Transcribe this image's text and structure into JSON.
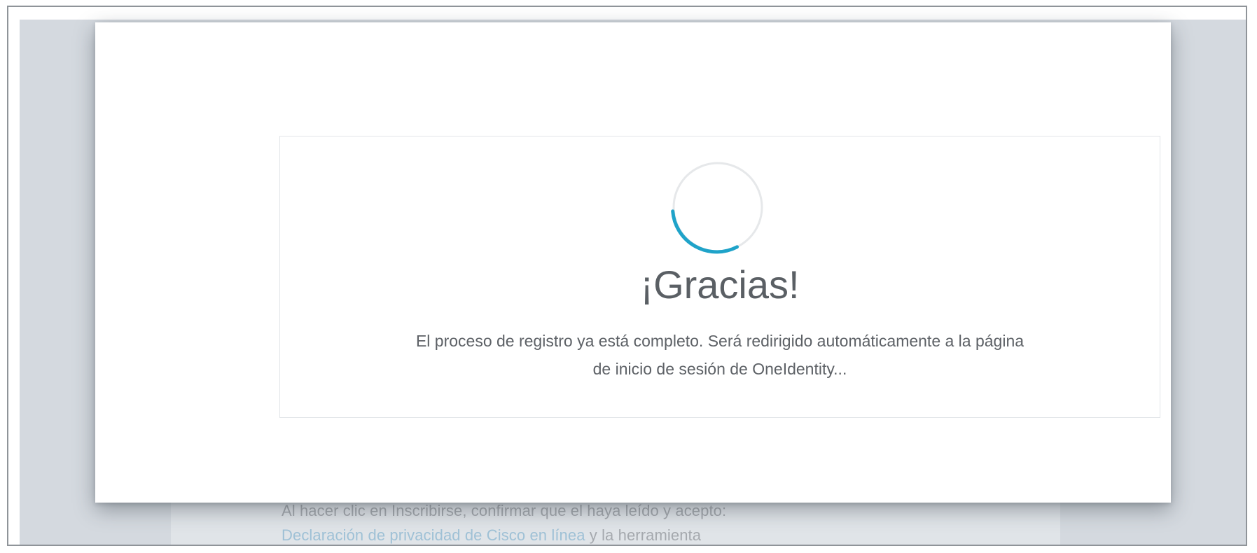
{
  "background_page": {
    "consent_text": "Al hacer clic en Inscribirse, confirmar que el haya leído y acepto:",
    "privacy_link": "Declaración de privacidad de Cisco en línea",
    "continuation_text": " y la herramienta"
  },
  "modal": {
    "spinner": {
      "icon": "loading-spinner-icon",
      "track_color": "#e6e8ea",
      "arc_color": "#1fa3c9"
    },
    "title": "¡Gracias!",
    "message_line1": "El proceso de registro ya está completo. Será redirigido automáticamente a la página",
    "message_line2": "de inicio de sesión de OneIdentity..."
  }
}
